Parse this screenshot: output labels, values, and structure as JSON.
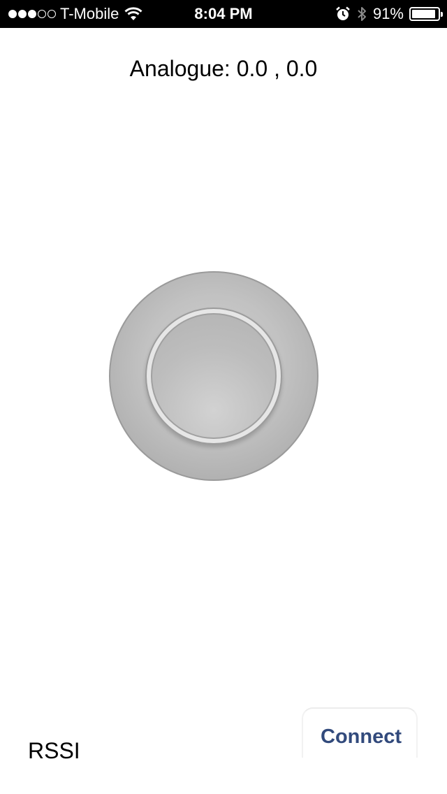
{
  "status_bar": {
    "signal_strength": 3,
    "signal_max": 5,
    "carrier": "T-Mobile",
    "time": "8:04 PM",
    "battery": "91%",
    "battery_level": 0.91,
    "icons": [
      "wifi-icon",
      "alarm-icon",
      "bluetooth-icon",
      "battery-icon"
    ]
  },
  "analogue": {
    "text": "Analogue: 0.0 , 0.0"
  },
  "joystick": {
    "x": 0.0,
    "y": 0.0
  },
  "bottom": {
    "rssi_label": "RSSI",
    "connect_label": "Connect"
  },
  "colors": {
    "accent": "#324a7c",
    "joystick_base": "#c2c2c2",
    "status_bar_bg": "#000000"
  }
}
